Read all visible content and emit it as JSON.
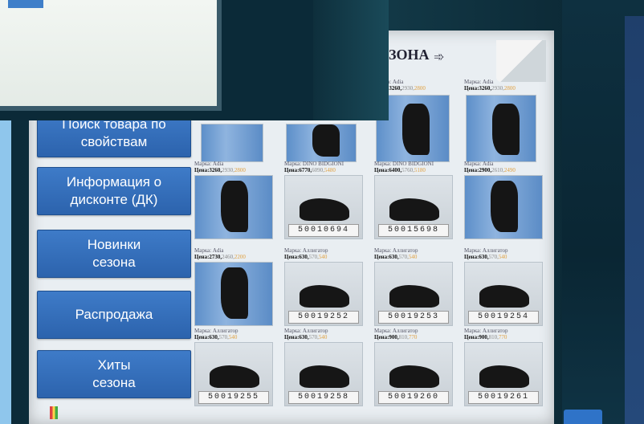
{
  "header": {
    "brand_fragment": "ЗОНА",
    "arrow_glyph": "➾"
  },
  "nav": {
    "items": [
      {
        "label_line1": "Поиск товара по",
        "label_line2": "свойствам"
      },
      {
        "label_line1": "Информация о",
        "label_line2": "дисконте (ДК)"
      },
      {
        "label_line1": "Новинки",
        "label_line2": "сезона"
      },
      {
        "label_line1": "Распродажа",
        "label_line2": ""
      },
      {
        "label_line1": "Хиты",
        "label_line2": "сезона"
      }
    ]
  },
  "top_row": [
    {
      "brand": "Марка: Adia",
      "price_main": "Цена:3260,",
      "price_alt1": "2930,",
      "price_alt2": "2800"
    },
    {
      "brand": "Марка: Adia",
      "price_main": "Цена:3260,",
      "price_alt1": "2930,",
      "price_alt2": "2800"
    }
  ],
  "products": [
    {
      "brand": "Марка: Adia",
      "price_main": "Цена:3260,",
      "price_alt1": "2930,",
      "price_alt2": "2800",
      "sku": "",
      "kind": "boot"
    },
    {
      "brand": "Марка: DINO BIDGIONI",
      "price_main": "Цена:6770,",
      "price_alt1": "6090,",
      "price_alt2": "5480",
      "sku": "50010694",
      "kind": "shoe"
    },
    {
      "brand": "Марка: DINO BIDGIONI",
      "price_main": "Цена:6400,",
      "price_alt1": "5760,",
      "price_alt2": "5180",
      "sku": "50015698",
      "kind": "shoe"
    },
    {
      "brand": "Марка: Adia",
      "price_main": "Цена:2900,",
      "price_alt1": "2610,",
      "price_alt2": "2490",
      "sku": "",
      "kind": "boot"
    },
    {
      "brand": "Марка: Adia",
      "price_main": "Цена:2730,",
      "price_alt1": "2460,",
      "price_alt2": "2200",
      "sku": "",
      "kind": "boot"
    },
    {
      "brand": "Марка: Аллигатор",
      "price_main": "Цена:630,",
      "price_alt1": "570,",
      "price_alt2": "540",
      "sku": "50019252",
      "kind": "shoe"
    },
    {
      "brand": "Марка: Аллигатор",
      "price_main": "Цена:630,",
      "price_alt1": "570,",
      "price_alt2": "540",
      "sku": "50019253",
      "kind": "shoe"
    },
    {
      "brand": "Марка: Аллигатор",
      "price_main": "Цена:630,",
      "price_alt1": "570,",
      "price_alt2": "540",
      "sku": "50019254",
      "kind": "shoe"
    },
    {
      "brand": "Марка: Аллигатор",
      "price_main": "Цена:630,",
      "price_alt1": "570,",
      "price_alt2": "540",
      "sku": "50019255",
      "kind": "shoe"
    },
    {
      "brand": "Марка: Аллигатор",
      "price_main": "Цена:630,",
      "price_alt1": "570,",
      "price_alt2": "540",
      "sku": "50019258",
      "kind": "shoe"
    },
    {
      "brand": "Марка: Аллигатор",
      "price_main": "Цена:900,",
      "price_alt1": "810,",
      "price_alt2": "770",
      "sku": "50019260",
      "kind": "shoe"
    },
    {
      "brand": "Марка: Аллигатор",
      "price_main": "Цена:900,",
      "price_alt1": "810,",
      "price_alt2": "770",
      "sku": "50019261",
      "kind": "shoe"
    }
  ],
  "colors": {
    "nav_button": "#3e7bc8",
    "price_highlight": "#e0a040",
    "thumb_blue": "#5d8fc9"
  }
}
